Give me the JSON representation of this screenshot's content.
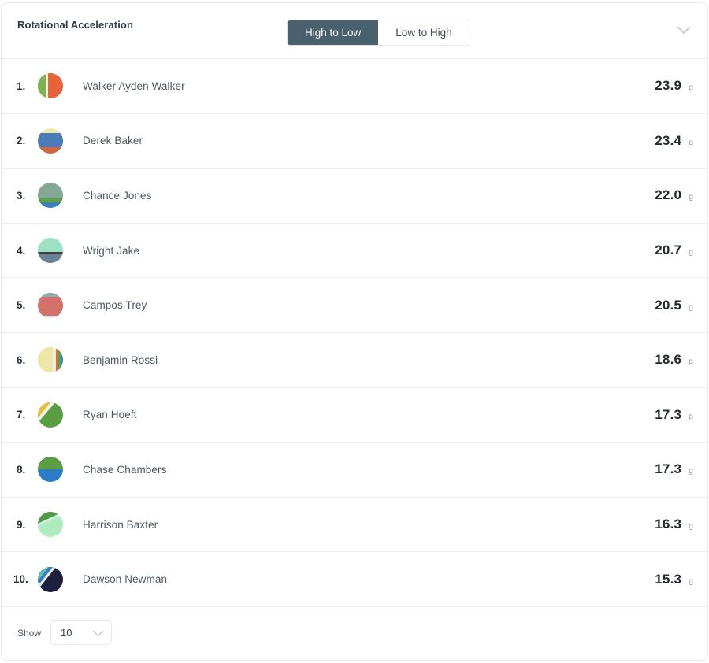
{
  "header": {
    "title": "Rotational Acceleration",
    "toggle": {
      "options": [
        {
          "label": "High to Low",
          "active": true
        },
        {
          "label": "Low to High",
          "active": false
        }
      ]
    },
    "collapse_icon": "chevron-down-icon"
  },
  "leaderboard": {
    "unit": "g",
    "rows": [
      {
        "rank": "1.",
        "name": "Walker Ayden Walker",
        "value": "23.9"
      },
      {
        "rank": "2.",
        "name": "Derek Baker",
        "value": "23.4"
      },
      {
        "rank": "3.",
        "name": "Chance Jones",
        "value": "22.0"
      },
      {
        "rank": "4.",
        "name": "Wright Jake",
        "value": "20.7"
      },
      {
        "rank": "5.",
        "name": "Campos Trey",
        "value": "20.5"
      },
      {
        "rank": "6.",
        "name": "Benjamin Rossi",
        "value": "18.6"
      },
      {
        "rank": "7.",
        "name": "Ryan Hoeft",
        "value": "17.3"
      },
      {
        "rank": "8.",
        "name": "Chase Chambers",
        "value": "17.3"
      },
      {
        "rank": "9.",
        "name": "Harrison Baxter",
        "value": "16.3"
      },
      {
        "rank": "10.",
        "name": "Dawson Newman",
        "value": "15.3"
      }
    ]
  },
  "footer": {
    "show_label": "Show",
    "page_size": "10",
    "chevron_icon": "chevron-down-icon"
  },
  "colors": {
    "toggle_active_bg": "#49606f",
    "value_text": "#24292f",
    "name_text": "#4b5763",
    "divider": "#eceef0"
  },
  "chart_data": {
    "type": "bar",
    "title": "Rotational Acceleration",
    "categories": [
      "Walker Ayden Walker",
      "Derek Baker",
      "Chance Jones",
      "Wright Jake",
      "Campos Trey",
      "Benjamin Rossi",
      "Ryan Hoeft",
      "Chase Chambers",
      "Harrison Baxter",
      "Dawson Newman"
    ],
    "values": [
      23.9,
      23.4,
      22.0,
      20.7,
      20.5,
      18.6,
      17.3,
      17.3,
      16.3,
      15.3
    ],
    "xlabel": "",
    "ylabel": "g",
    "ylim": [
      0,
      25
    ],
    "sort": "High to Low"
  }
}
